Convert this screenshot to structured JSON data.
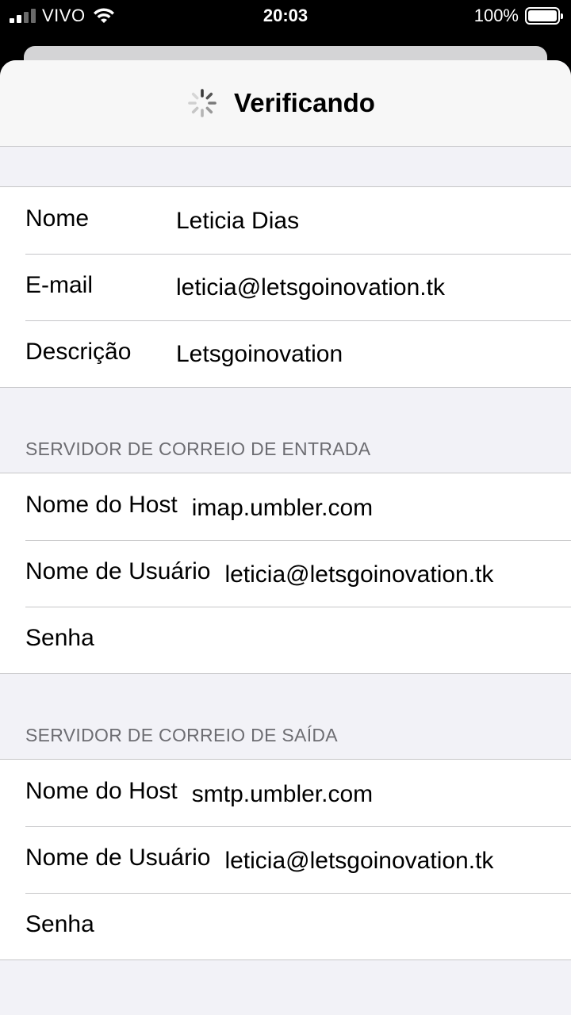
{
  "status_bar": {
    "carrier": "VIVO",
    "time": "20:03",
    "battery": "100%"
  },
  "nav": {
    "title": "Verificando"
  },
  "account": {
    "rows": [
      {
        "label": "Nome",
        "value": "Leticia Dias"
      },
      {
        "label": "E-mail",
        "value": "leticia@letsgoinovation.tk"
      },
      {
        "label": "Descrição",
        "value": "Letsgoinovation"
      }
    ]
  },
  "incoming": {
    "header": "SERVIDOR DE CORREIO DE ENTRADA",
    "rows": [
      {
        "label": "Nome do Host",
        "value": "imap.umbler.com"
      },
      {
        "label": "Nome de Usuário",
        "value": "leticia@letsgoinovation.tk"
      },
      {
        "label": "Senha",
        "value": ""
      }
    ]
  },
  "outgoing": {
    "header": "SERVIDOR DE CORREIO DE SAÍDA",
    "rows": [
      {
        "label": "Nome do Host",
        "value": "smtp.umbler.com"
      },
      {
        "label": "Nome de Usuário",
        "value": "leticia@letsgoinovation.tk"
      },
      {
        "label": "Senha",
        "value": ""
      }
    ]
  }
}
